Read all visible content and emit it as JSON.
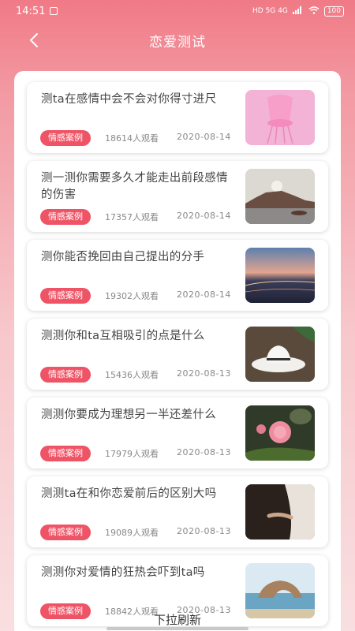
{
  "status": {
    "time": "14:51",
    "indicators": "HD 5G 4G",
    "battery": "100"
  },
  "nav": {
    "title": "恋爱测试"
  },
  "colors": {
    "accent": "#ee5466",
    "header_bg": "#f07a86"
  },
  "articles": [
    {
      "title": "测ta在感情中会不会对你得寸进尺",
      "tag": "情感案例",
      "views": "18614人观看",
      "date": "2020-08-14",
      "image": "pink-chair-icon"
    },
    {
      "title": "测一测你需要多久才能走出前段感情的伤害",
      "tag": "情感案例",
      "views": "17357人观看",
      "date": "2020-08-14",
      "image": "seaside-sunset-icon"
    },
    {
      "title": "测你能否挽回由自己提出的分手",
      "tag": "情感案例",
      "views": "19302人观看",
      "date": "2020-08-14",
      "image": "city-dusk-icon"
    },
    {
      "title": "测测你和ta互相吸引的点是什么",
      "tag": "情感案例",
      "views": "15436人观看",
      "date": "2020-08-13",
      "image": "white-hat-icon"
    },
    {
      "title": "测测你要成为理想另一半还差什么",
      "tag": "情感案例",
      "views": "17979人观看",
      "date": "2020-08-13",
      "image": "pink-flower-icon"
    },
    {
      "title": "测测ta在和你恋爱前后的区别大吗",
      "tag": "情感案例",
      "views": "19089人观看",
      "date": "2020-08-13",
      "image": "couple-hands-icon"
    },
    {
      "title": "测测你对爱情的狂热会吓到ta吗",
      "tag": "情感案例",
      "views": "18842人观看",
      "date": "2020-08-13",
      "image": "sea-arch-icon"
    }
  ],
  "footer": {
    "refresh_hint": "下拉刷新"
  }
}
